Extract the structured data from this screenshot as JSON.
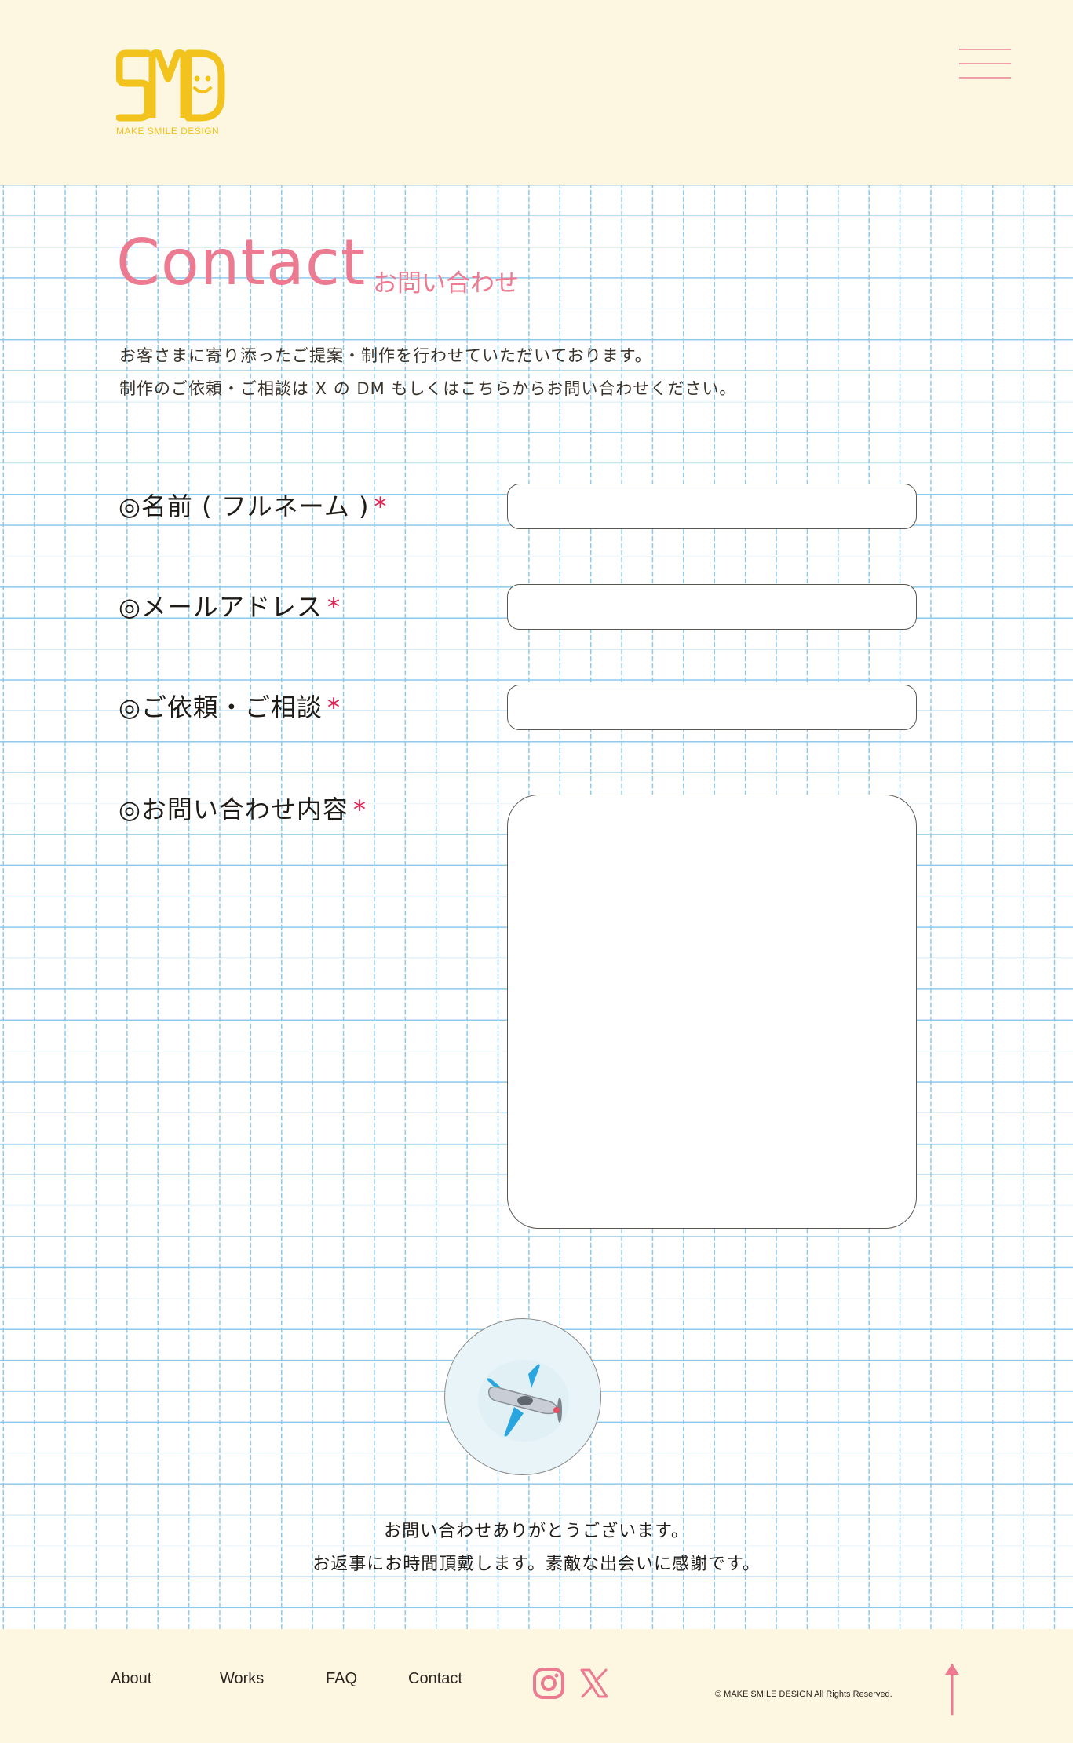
{
  "brand": {
    "logo_text": "SMD",
    "logo_caption": "MAKE SMILE DESIGN",
    "colors": {
      "logo": "#f2c21d",
      "accent": "#ec7b92",
      "required": "#e0214f",
      "header_bg": "#fdf7e2",
      "grid": "#8ec9ea"
    }
  },
  "header": {
    "menu_icon": "hamburger-icon"
  },
  "page": {
    "title_en": "Contact",
    "title_jp": "お問い合わせ",
    "intro_line1": "お客さまに寄り添ったご提案・制作を行わせていただいております。",
    "intro_line2": "制作のご依頼・ご相談は X の DM もしくはこちらからお問い合わせください。"
  },
  "form": {
    "name_label": "◎名前 ( フルネーム )",
    "email_label": "◎メールアドレス",
    "topic_label": "◎ご依頼・ご相談",
    "message_label": "◎お問い合わせ内容",
    "required_mark": "*",
    "name_value": "",
    "email_value": "",
    "topic_value": "",
    "message_value": "",
    "submit_icon": "airplane-icon"
  },
  "thanks": {
    "line1": "お問い合わせありがとうございます。",
    "line2": "お返事にお時間頂戴します。素敵な出会いに感謝です。"
  },
  "footer": {
    "nav": [
      "About",
      "Works",
      "FAQ",
      "Contact"
    ],
    "social_icons": [
      "instagram-icon",
      "x-icon"
    ],
    "copyright": "© MAKE SMILE DESIGN All Rights Reserved.",
    "top_icon": "arrow-up-icon"
  }
}
